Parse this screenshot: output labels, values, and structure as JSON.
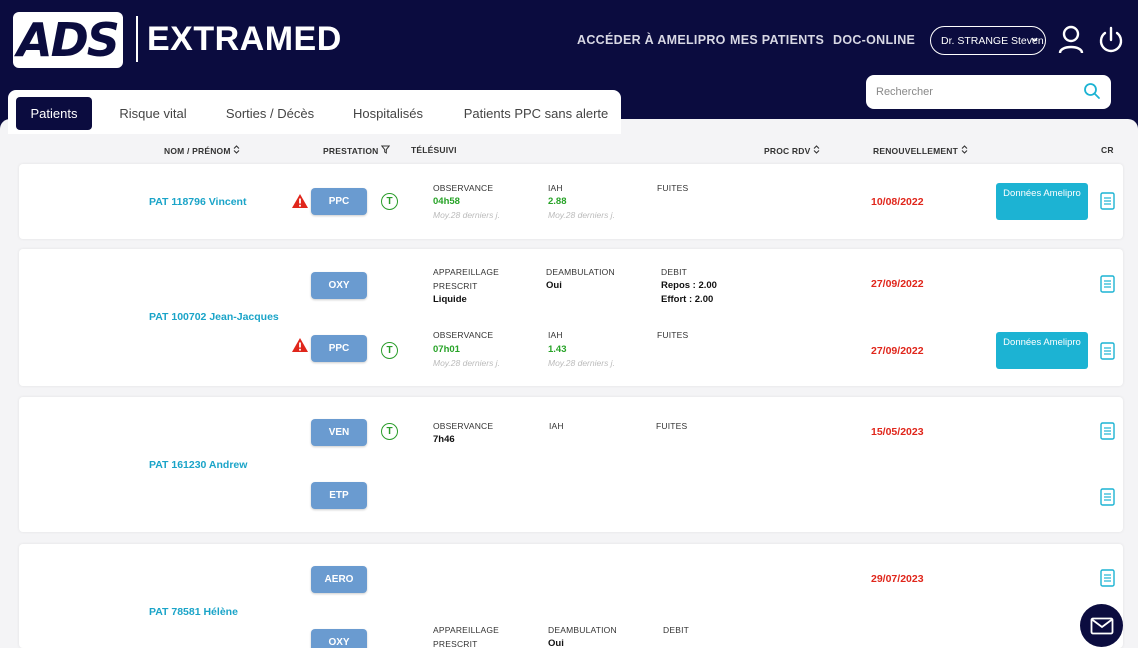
{
  "header": {
    "logo_text": "ADS",
    "brand": "EXTRAMED",
    "nav": [
      "ACCÉDER À AMELIPRO",
      "MES PATIENTS",
      "DOC-ONLINE"
    ],
    "user": "Dr. STRANGE Steven",
    "search_placeholder": "Rechercher"
  },
  "tabs": [
    "Patients",
    "Risque vital",
    "Sorties / Décès",
    "Hospitalisés",
    "Patients PPC sans alerte"
  ],
  "columns": {
    "nom": "NOM / PRÉNOM",
    "prestation": "PRESTATION",
    "telesuivi": "TÉLÉSUIVI",
    "proc_rdv": "PROC RDV",
    "renouvellement": "RENOUVELLEMENT",
    "cr": "CR"
  },
  "patients": [
    {
      "name": "PAT 118796 Vincent",
      "rows": [
        {
          "badge": "PPC",
          "telesuivi": "T",
          "labels": [
            "OBSERVANCE",
            "IAH",
            "FUITES"
          ],
          "values": [
            "04h58",
            "2.88"
          ],
          "subs": [
            "Moy.28 derniers j.",
            "Moy.28 derniers j."
          ],
          "date": "10/08/2022",
          "ameli": "Données Amelipro"
        }
      ]
    },
    {
      "name": "PAT 100702 Jean-Jacques",
      "rows": [
        {
          "badge": "OXY",
          "labels": [
            "APPAREILLAGE",
            "DEAMBULATION",
            "DEBIT"
          ],
          "label2": "PRESCRIT",
          "values": [
            "Liquide",
            "Oui",
            "Repos : 2.00",
            "Effort : 2.00"
          ],
          "date": "27/09/2022"
        },
        {
          "badge": "PPC",
          "telesuivi": "T",
          "labels": [
            "OBSERVANCE",
            "IAH",
            "FUITES"
          ],
          "values": [
            "07h01",
            "1.43"
          ],
          "subs": [
            "Moy.28 derniers j.",
            "Moy.28 derniers j."
          ],
          "date": "27/09/2022",
          "ameli": "Données Amelipro"
        }
      ]
    },
    {
      "name": "PAT 161230 Andrew",
      "rows": [
        {
          "badge": "VEN",
          "telesuivi": "T",
          "labels": [
            "OBSERVANCE",
            "IAH",
            "FUITES"
          ],
          "values": [
            "7h46"
          ],
          "date": "15/05/2023"
        },
        {
          "badge": "ETP"
        }
      ]
    },
    {
      "name": "PAT 78581 Hélène",
      "rows": [
        {
          "badge": "AERO",
          "date": "29/07/2023"
        },
        {
          "badge": "OXY",
          "labels": [
            "APPAREILLAGE",
            "DEAMBULATION",
            "DEBIT"
          ],
          "label2": "PRESCRIT",
          "values": [
            "Oui"
          ]
        }
      ]
    }
  ],
  "colors": {
    "navy": "#0b0c3f",
    "cyan": "#1cb3d3",
    "red": "#e0261b",
    "green": "#27a327",
    "badge": "#6a9bd0"
  }
}
